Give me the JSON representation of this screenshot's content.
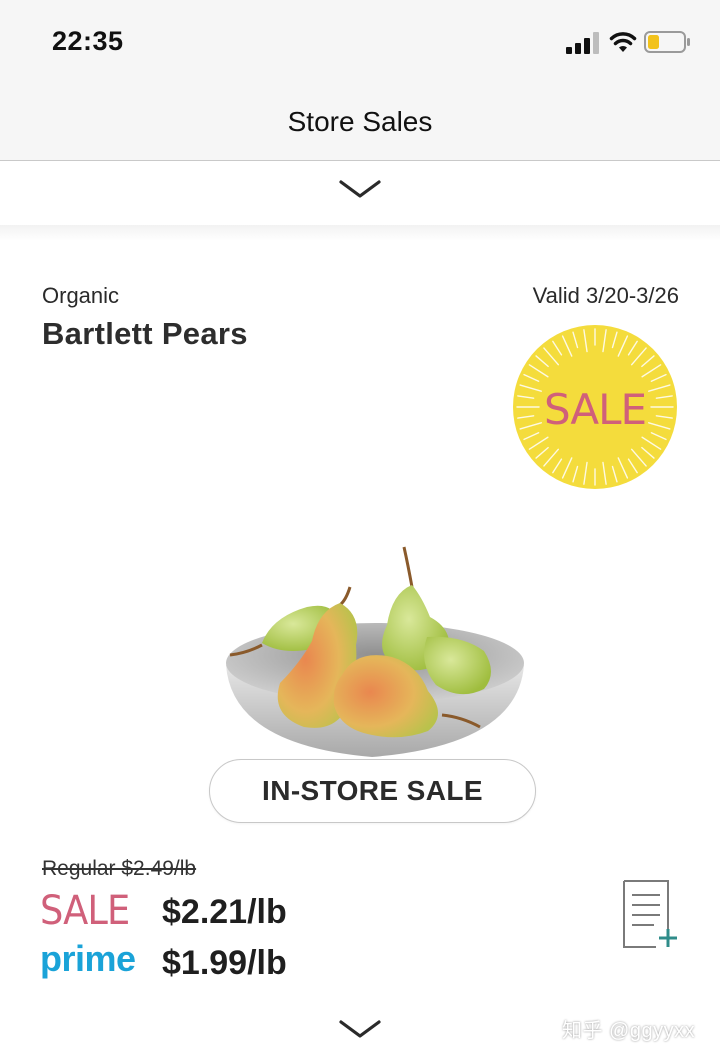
{
  "status_bar": {
    "time": "22:35",
    "icons": [
      "cellular-signal-icon",
      "wifi-icon",
      "battery-icon"
    ]
  },
  "nav": {
    "title": "Store Sales",
    "expand_icon": "chevron-down-icon"
  },
  "product": {
    "subtitle": "Organic",
    "title": "Bartlett Pears",
    "valid": "Valid 3/20-3/26",
    "badge_text": "SALE",
    "image": "pears-in-bowl",
    "instore_label": "IN-STORE SALE",
    "regular_price": "Regular $2.49/lb",
    "sale_label": "SALE",
    "sale_price": "$2.21/lb",
    "prime_label": "prime",
    "prime_price": "$1.99/lb",
    "add_icon": "add-to-list-icon"
  },
  "footer": {
    "more_icon": "chevron-down-icon"
  },
  "watermark": "知乎 @ggyyxx",
  "colors": {
    "sale_pink": "#d0607a",
    "badge_yellow": "#f4dc3c",
    "prime_blue": "#1aa3d8",
    "icon_teal": "#2f8c8a"
  }
}
